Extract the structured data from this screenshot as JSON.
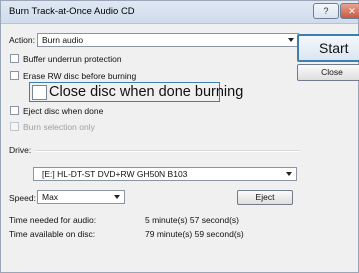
{
  "window": {
    "title": "Burn Track-at-Once Audio CD",
    "help_button": "?",
    "close_button": "✕"
  },
  "action": {
    "label": "Action:",
    "label_underline": "A",
    "value": "Burn audio"
  },
  "options": {
    "buffer_underrun": "Buffer underrun protection",
    "erase_rw": "Erase RW disc before burning",
    "close_disc": "Close disc when done burning",
    "eject_disc": "Eject disc when done",
    "burn_selection": "Burn selection only"
  },
  "drive": {
    "label": "Drive:",
    "value": "[E:] HL-DT-ST DVD+RW GH50N B103"
  },
  "speed": {
    "label": "Speed:",
    "value": "Max"
  },
  "buttons": {
    "start": "Start",
    "close": "Close",
    "eject": "Eject"
  },
  "info": {
    "time_needed_label": "Time needed for audio:",
    "time_needed_value": "5 minute(s) 57 second(s)",
    "time_available_label": "Time available on disc:",
    "time_available_value": "79 minute(s) 59 second(s)"
  }
}
